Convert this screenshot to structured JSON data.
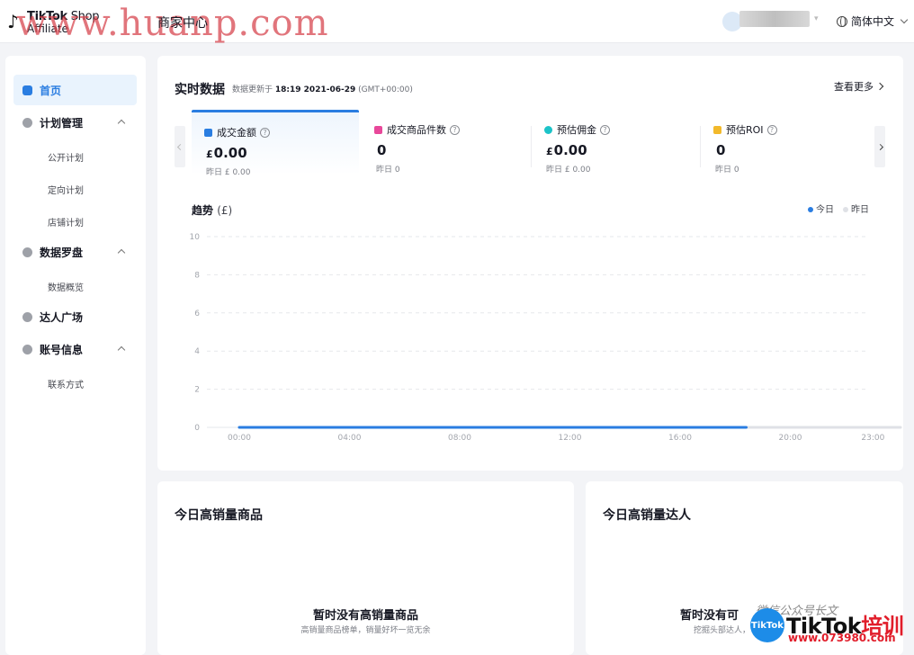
{
  "header": {
    "logo_line1_bold": "TikTok",
    "logo_line1_light": " Shop",
    "logo_line2": "Affiliate",
    "watermark_url": "www.huanp.com",
    "title": "商家中心",
    "language": "简体中文"
  },
  "sidebar": {
    "items": [
      {
        "label": "首页",
        "active": true
      },
      {
        "label": "计划管理",
        "expandable": true
      },
      {
        "label": "数据罗盘",
        "expandable": true
      },
      {
        "label": "达人广场"
      },
      {
        "label": "账号信息",
        "expandable": true
      }
    ],
    "subs": {
      "plan_public": "公开计划",
      "plan_targeted": "定向计划",
      "plan_shop": "店铺计划",
      "data_overview": "数据概览",
      "contact": "联系方式"
    }
  },
  "realtime": {
    "title": "实时数据",
    "updated_prefix": "数据更新于",
    "updated_time": "18:19 2021-06-29",
    "timezone": "(GMT+00:00)",
    "more": "查看更多",
    "metrics": [
      {
        "label": "成交金额",
        "currency": "£",
        "value": "0.00",
        "prev": "昨日 £ 0.00",
        "color": "#2a7de1"
      },
      {
        "label": "成交商品件数",
        "currency": "",
        "value": "0",
        "prev": "昨日 0",
        "color": "#e8489a"
      },
      {
        "label": "预估佣金",
        "currency": "£",
        "value": "0.00",
        "prev": "昨日 £ 0.00",
        "color": "#1cc3c8"
      },
      {
        "label": "预估ROI",
        "currency": "",
        "value": "0",
        "prev": "昨日 0",
        "color": "#f2b92b"
      }
    ]
  },
  "trend": {
    "title": "趋势",
    "unit": "(£)",
    "legend_today": "今日",
    "legend_yesterday": "昨日",
    "today_color": "#2a7de1",
    "yesterday_color": "#dfe1e6"
  },
  "chart_data": {
    "type": "line",
    "title": "趋势",
    "ylim": [
      0,
      10
    ],
    "yticks": [
      "10",
      "8",
      "6",
      "4",
      "2",
      "0"
    ],
    "xticks": [
      "00:00",
      "04:00",
      "08:00",
      "12:00",
      "16:00",
      "20:00",
      "23:00"
    ],
    "series": [
      {
        "name": "今日",
        "color": "#2a7de1",
        "x": [
          0,
          18.4
        ],
        "y": [
          0,
          0
        ]
      },
      {
        "name": "昨日",
        "color": "#dfe1e6",
        "x": [
          0,
          24
        ],
        "y": [
          0,
          0
        ]
      }
    ]
  },
  "products": {
    "title": "今日高销量商品",
    "empty_title": "暂时没有高销量商品",
    "empty_sub": "高销量商品榜单，销量好坏一览无余"
  },
  "creators": {
    "title": "今日高销量达人",
    "empty_title": "暂时没有可",
    "empty_sub": "挖掘头部达人，"
  },
  "watermark2": {
    "badge": "TikTok",
    "brand_black": "TikTok",
    "brand_red": "培训",
    "url": "www.073980.com",
    "script": "微信公众号长文"
  }
}
